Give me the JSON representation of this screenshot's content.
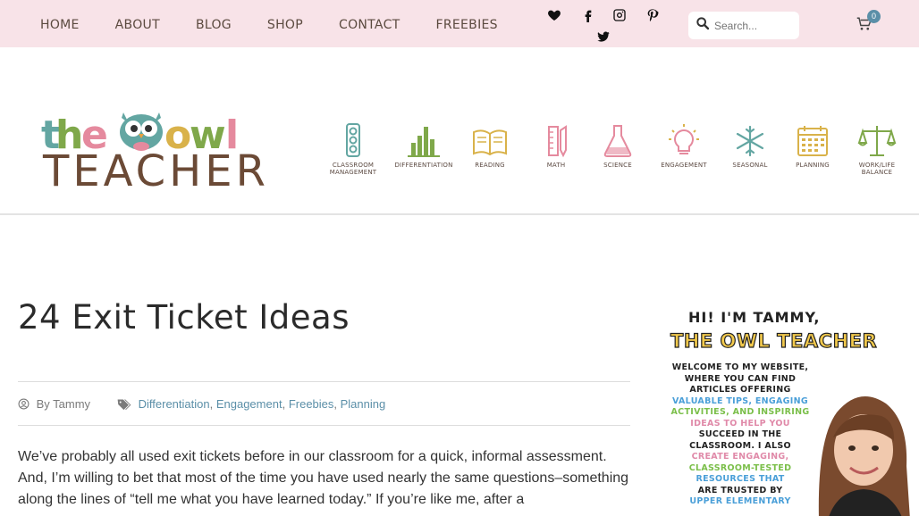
{
  "nav": {
    "items": [
      "HOME",
      "ABOUT",
      "BLOG",
      "SHOP",
      "CONTACT",
      "FREEBIES"
    ]
  },
  "social": [
    "heart-icon",
    "facebook-icon",
    "instagram-icon",
    "pinterest-icon",
    "twitter-icon"
  ],
  "search": {
    "placeholder": "Search..."
  },
  "cart": {
    "count": "0"
  },
  "logo": {
    "line1": "the owl",
    "line2": "TEACHER"
  },
  "categories": [
    {
      "label": "CLASSROOM MANAGEMENT",
      "icon": "traffic-light-icon"
    },
    {
      "label": "DIFFERENTIATION",
      "icon": "bar-chart-icon"
    },
    {
      "label": "READING",
      "icon": "book-icon"
    },
    {
      "label": "MATH",
      "icon": "ruler-pencil-icon"
    },
    {
      "label": "SCIENCE",
      "icon": "flask-icon"
    },
    {
      "label": "ENGAGEMENT",
      "icon": "lightbulb-icon"
    },
    {
      "label": "SEASONAL",
      "icon": "snowflake-icon"
    },
    {
      "label": "PLANNING",
      "icon": "calendar-icon"
    },
    {
      "label": "WORK/LIFE BALANCE",
      "icon": "scales-icon"
    }
  ],
  "post": {
    "title": "24 Exit Ticket Ideas",
    "author": "By Tammy",
    "categories": [
      "Differentiation",
      "Engagement",
      "Freebies",
      "Planning"
    ],
    "body": "We’ve probably all used exit tickets before in our classroom for a quick, informal assessment. And, I’m willing to bet that most of the time you have used nearly the same questions–something along the lines of “tell me what you have learned today.” If you’re like me, after a"
  },
  "sidebar": {
    "greeting": "HI! I'M TAMMY,",
    "name": "THE OWL TEACHER",
    "intro": [
      "WELCOME TO MY WEBSITE,",
      "WHERE YOU CAN FIND",
      "ARTICLES OFFERING",
      "VALUABLE TIPS, ENGAGING",
      "ACTIVITIES, AND INSPIRING",
      "IDEAS TO HELP YOU",
      "SUCCEED IN THE",
      "CLASSROOM. I ALSO",
      "CREATE ENGAGING,",
      "CLASSROOM-TESTED",
      "RESOURCES THAT",
      "ARE TRUSTED BY",
      "UPPER ELEMENTARY"
    ]
  },
  "colors": {
    "topbar": "#f8e3e8",
    "accent": "#5b8fa8",
    "icon_teal": "#63a6a2",
    "icon_green": "#7fa84a",
    "icon_yellow": "#d9b24a",
    "icon_pink": "#e58a9e"
  }
}
